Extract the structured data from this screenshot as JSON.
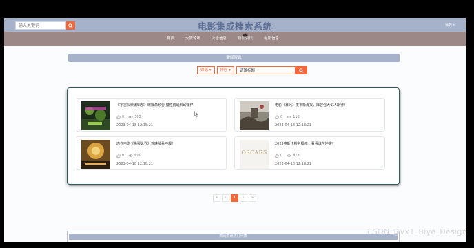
{
  "header": {
    "search_placeholder": "输入关键词",
    "title": "电影集成搜索系统",
    "user_label": "我的 ▾"
  },
  "nav": {
    "items": [
      {
        "label": "首页"
      },
      {
        "label": "交流论坛"
      },
      {
        "label": "公告信息"
      },
      {
        "label": "新闻资讯"
      },
      {
        "label": "电影信息"
      }
    ],
    "active_index": 3
  },
  "section": {
    "title": "新闻资讯"
  },
  "filters": {
    "filter_label": "筛选 ▾",
    "sort_label": "排序 ▾",
    "search_value": "请输标题"
  },
  "news": [
    {
      "title": "《宇宙探索编辑部》曝概念预告 魔性荒诞科幻爆停",
      "likes": "0",
      "views": "305",
      "date": "2023-04-18 12:18:21",
      "thumb": "movie-poster-green"
    },
    {
      "title": "电影《暴风》发布新海报，阵容强大令人期待！",
      "likes": "0",
      "views": "118",
      "date": "2023-04-18 12:18:21",
      "thumb": "movie-poster-storm"
    },
    {
      "title": "动作电影《撕裂世界》首映播看冲爆！",
      "likes": "0",
      "views": "690",
      "date": "2023-04-18 12:18:21",
      "thumb": "movie-poster-gold"
    },
    {
      "title": "2023奥斯卡提名揭晓，看看谁在冲奖?",
      "likes": "0",
      "views": "813",
      "date": "2023-04-18 12:18:21",
      "thumb": "oscars-logo",
      "thumb_text": "OSCARS"
    }
  ],
  "pagination": {
    "first": "«",
    "prev": "‹",
    "current": "1",
    "next": "›",
    "last": "»"
  },
  "bottom": {
    "title": "新闻资讯热门列表"
  },
  "watermark": "CSDN @vx1_Biye_Design",
  "colors": {
    "accent": "#f0683c",
    "topbar": "#a6b2c9",
    "navbar": "#9c8887",
    "title": "#5d6f94"
  }
}
